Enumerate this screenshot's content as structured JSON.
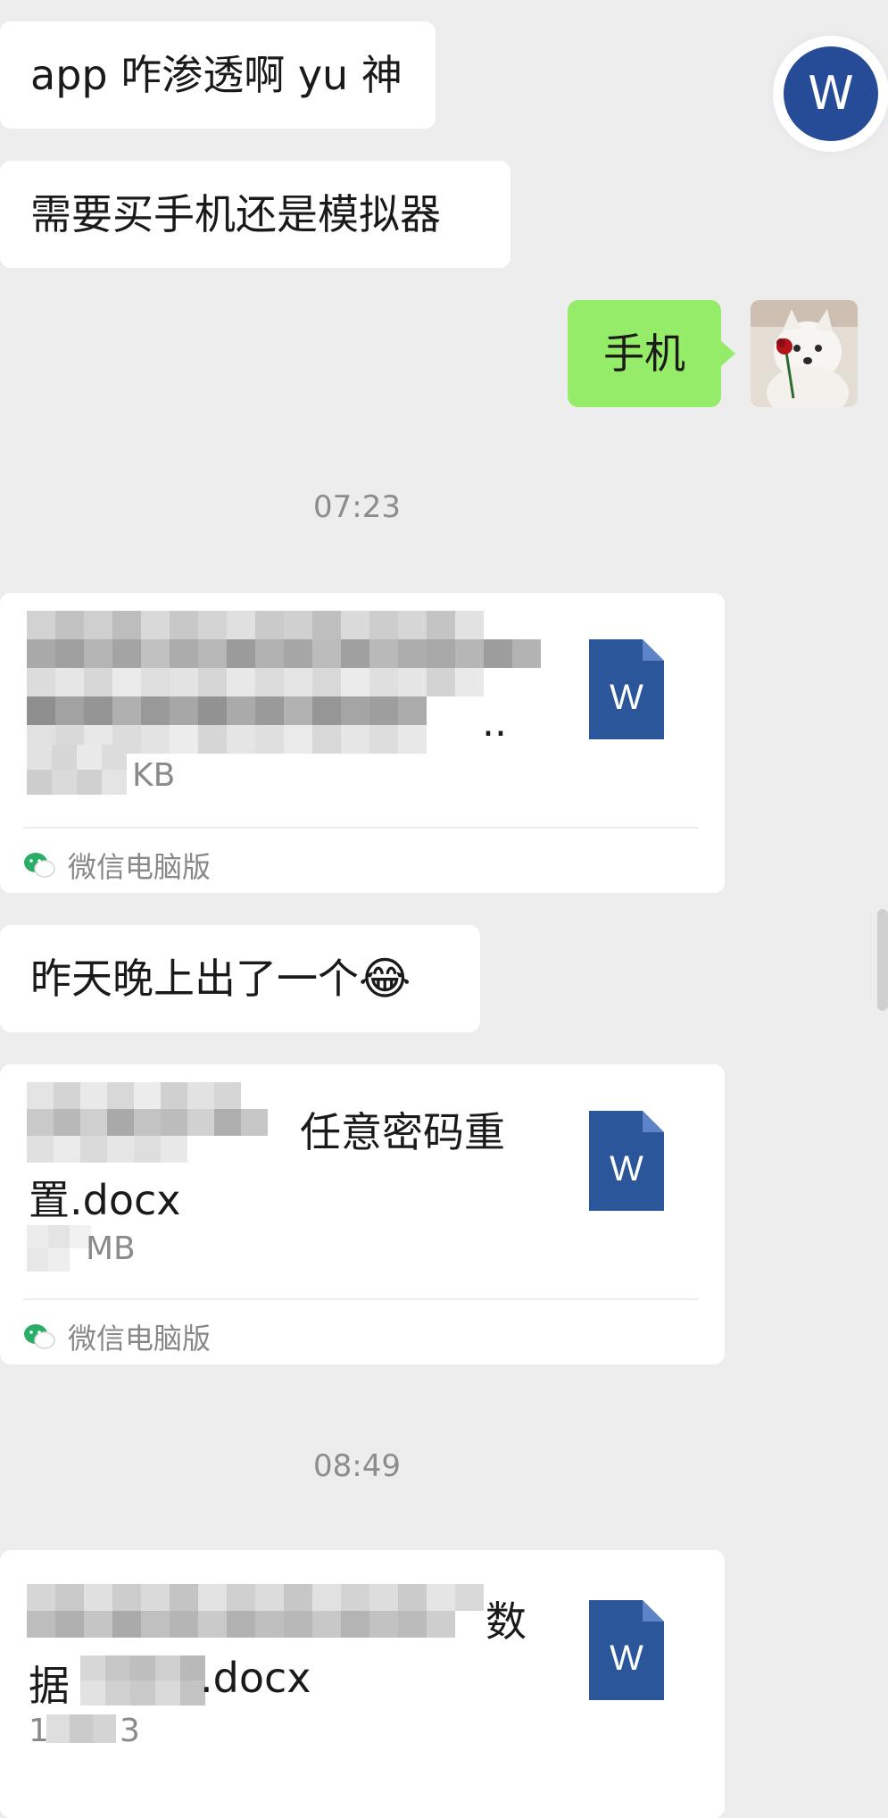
{
  "messages": {
    "m1": "app 咋渗透啊 yu 神",
    "m2": "需要买手机还是模拟器",
    "m3_me": "手机",
    "m4": "昨天晚上出了一个",
    "m4_emoji": "😂"
  },
  "timestamps": [
    "07:23",
    "08:49"
  ],
  "files": [
    {
      "title_visible": "",
      "title_ellipsis": "..",
      "size": "KB",
      "source": "微信电脑版",
      "icon_letter": "W"
    },
    {
      "title_line1": "任意密码重",
      "title_line2": "置.docx",
      "size": "MB",
      "source": "微信电脑版",
      "icon_letter": "W"
    },
    {
      "title_line1": "数",
      "title_line2_a": "据",
      "title_line2_b": ".docx",
      "size_a": "1",
      "size_b": "3",
      "icon_letter": "W"
    }
  ],
  "badge": {
    "letter": "W",
    "color": "#264c97"
  },
  "colors": {
    "background": "#ededed",
    "my_bubble": "#95ec69",
    "doc_icon": "#2b579a",
    "wechat_green": "#2aae67"
  },
  "icons": {
    "doc": "word-document-icon",
    "source": "wechat-icon",
    "avatar": "samoyed-with-rose-avatar"
  }
}
